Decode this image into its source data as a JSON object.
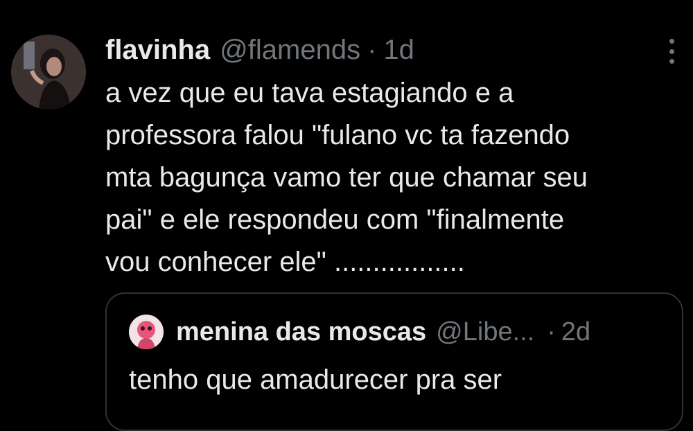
{
  "tweet": {
    "author": {
      "display_name": "flavinha",
      "handle": "@flamends",
      "avatar_icon": "user-avatar-photo"
    },
    "separator": "·",
    "time": "1d",
    "more_icon": "more-options-icon",
    "text_lines": [
      "a vez que eu tava estagiando e a",
      "professora falou \"fulano vc ta fazendo",
      "mta bagunça vamo ter que chamar seu",
      "pai\" e ele respondeu com \"finalmente",
      "vou conhecer ele\" ................."
    ]
  },
  "quote": {
    "author": {
      "display_name": "menina das moscas",
      "handle": "@Libe...",
      "avatar_icon": "quoted-user-avatar"
    },
    "separator": "·",
    "time": "2d",
    "text": "tenho que amadurecer pra ser"
  },
  "colors": {
    "background": "#000000",
    "primary_text": "#e7e9ea",
    "secondary_text": "#71767b",
    "border": "#2f3336"
  }
}
